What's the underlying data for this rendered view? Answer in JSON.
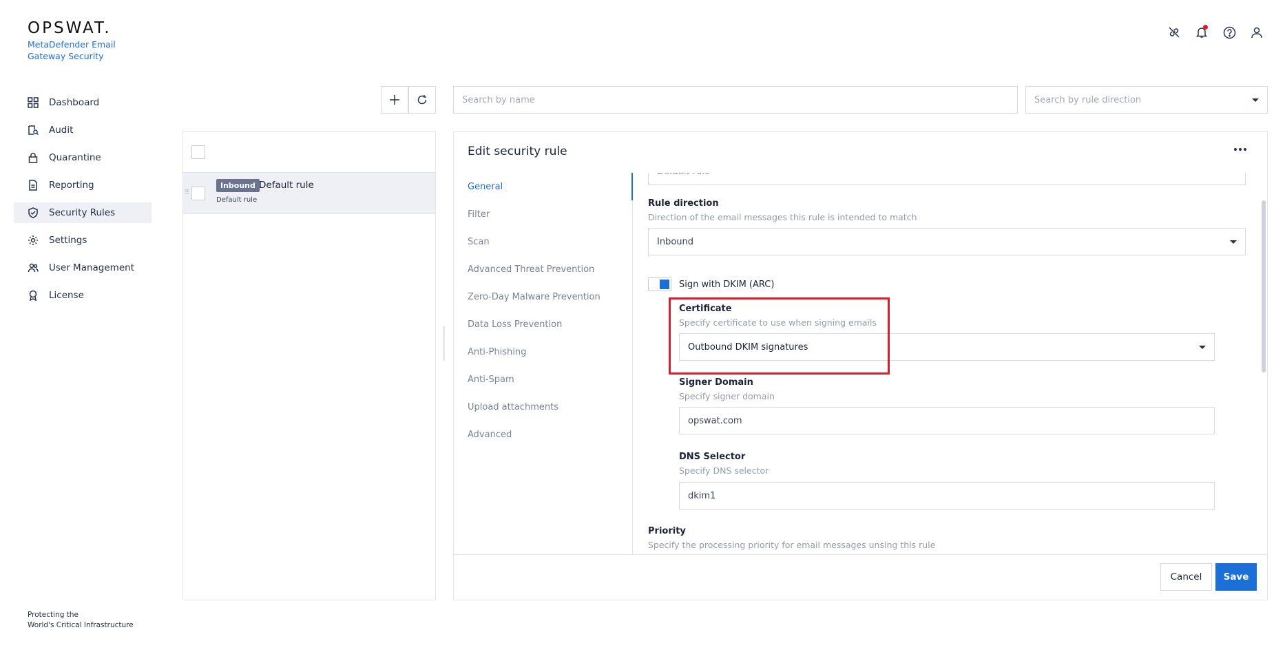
{
  "brand": {
    "logo": "OPSWAT.",
    "product": "MetaDefender Email Gateway Security",
    "footer_line1": "Protecting the",
    "footer_line2": "World's Critical Infrastructure"
  },
  "sidebar": {
    "items": [
      {
        "label": "Dashboard",
        "icon": "dashboard-icon"
      },
      {
        "label": "Audit",
        "icon": "audit-icon"
      },
      {
        "label": "Quarantine",
        "icon": "lock-icon"
      },
      {
        "label": "Reporting",
        "icon": "document-icon"
      },
      {
        "label": "Security Rules",
        "icon": "shield-icon",
        "active": true
      },
      {
        "label": "Settings",
        "icon": "gear-icon"
      },
      {
        "label": "User Management",
        "icon": "users-icon"
      },
      {
        "label": "License",
        "icon": "badge-icon"
      }
    ]
  },
  "header": {
    "icons": [
      "link-icon",
      "bell-icon",
      "help-icon",
      "user-icon"
    ],
    "notification_color": "#e01e2b"
  },
  "toolbar": {
    "search_name_placeholder": "Search by name",
    "search_direction_placeholder": "Search by rule direction"
  },
  "rules": {
    "items": [
      {
        "badge": "Inbound",
        "name": "Default rule",
        "sub": "Default rule"
      }
    ]
  },
  "edit": {
    "title": "Edit security rule",
    "tabs": [
      "General",
      "Filter",
      "Scan",
      "Advanced Threat Prevention",
      "Zero-Day Malware Prevention",
      "Data Loss Prevention",
      "Anti-Phishing",
      "Anti-Spam",
      "Upload attachments",
      "Advanced"
    ],
    "active_tab": "General",
    "form": {
      "name_value": "Default rule",
      "rule_direction_label": "Rule direction",
      "rule_direction_desc": "Direction of the email messages this rule is intended to match",
      "rule_direction_value": "Inbound",
      "dkim_toggle_label": "Sign with DKIM (ARC)",
      "dkim_enabled": true,
      "certificate_label": "Certificate",
      "certificate_desc": "Specify certificate to use when signing emails",
      "certificate_value": "Outbound DKIM signatures",
      "signer_domain_label": "Signer Domain",
      "signer_domain_desc": "Specify signer domain",
      "signer_domain_value": "opswat.com",
      "dns_selector_label": "DNS Selector",
      "dns_selector_desc": "Specify DNS selector",
      "dns_selector_value": "dkim1",
      "priority_label": "Priority",
      "priority_desc": "Specify the processing priority for email messages unsing this rule"
    },
    "cancel_label": "Cancel",
    "save_label": "Save"
  },
  "colors": {
    "accent": "#1d6fd8",
    "highlight": "#e21b2a",
    "badge": "#6a738d"
  }
}
